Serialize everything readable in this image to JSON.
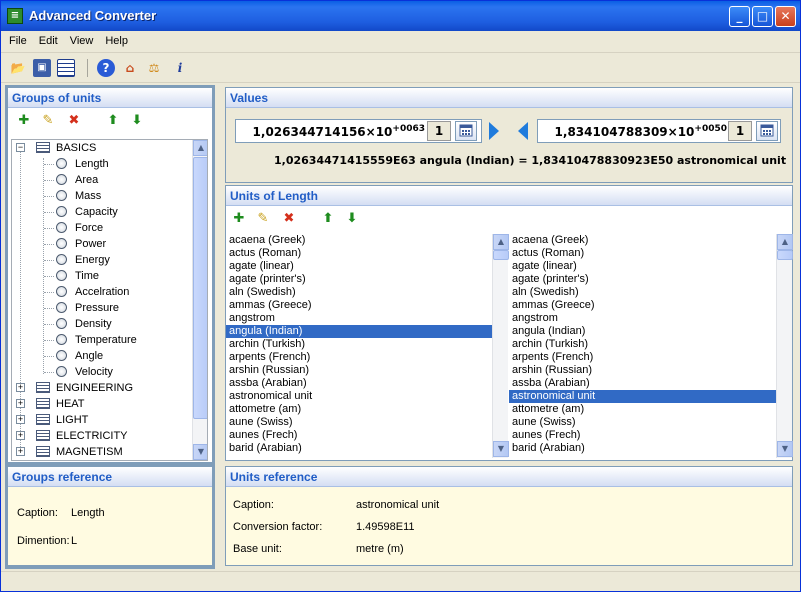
{
  "window": {
    "title": "Advanced Converter",
    "app_icon": "converter-app-icon"
  },
  "menu": [
    "File",
    "Edit",
    "View",
    "Help"
  ],
  "toolbar_icons": [
    "open-icon",
    "save-icon",
    "list-icon",
    "help-icon",
    "home-icon",
    "converter-icon",
    "info-icon"
  ],
  "groups": {
    "title": "Groups of units",
    "tools": [
      "add-group-icon",
      "edit-group-icon",
      "delete-group-icon",
      "move-up-icon",
      "move-down-icon"
    ],
    "tree": [
      {
        "label": "BASICS",
        "expanded": true,
        "children": [
          "Length",
          "Area",
          "Mass",
          "Capacity",
          "Force",
          "Power",
          "Energy",
          "Time",
          "Accelration",
          "Pressure",
          "Density",
          "Temperature",
          "Angle",
          "Velocity"
        ]
      },
      {
        "label": "ENGINEERING",
        "expanded": false
      },
      {
        "label": "HEAT",
        "expanded": false
      },
      {
        "label": "LIGHT",
        "expanded": false
      },
      {
        "label": "ELECTRICITY",
        "expanded": false
      },
      {
        "label": "MAGNETISM",
        "expanded": false
      }
    ]
  },
  "groups_reference": {
    "title": "Groups reference",
    "caption_label": "Caption:",
    "caption_value": "Length",
    "dimension_label": "Dimention:",
    "dimension_value": "L"
  },
  "values": {
    "title": "Values",
    "left": {
      "mantissa": "1,026344714156×10",
      "exponent": "+0063",
      "multiplier": "1"
    },
    "right": {
      "mantissa": "1,834104788309×10",
      "exponent": "+0050",
      "multiplier": "1"
    },
    "result": "1,02634471415559E63 angula (Indian) = 1,83410478830923E50 astronomical unit"
  },
  "units": {
    "title": "Units of Length",
    "tools": [
      "add-unit-icon",
      "edit-unit-icon",
      "delete-unit-icon",
      "unit-up-icon",
      "unit-down-icon"
    ],
    "list": [
      "acaena (Greek)",
      "actus (Roman)",
      "agate (linear)",
      "agate (printer's)",
      "aln (Swedish)",
      "ammas (Greece)",
      "angstrom",
      "angula (Indian)",
      "archin (Turkish)",
      "arpents (French)",
      "arshin (Russian)",
      "assba (Arabian)",
      "astronomical unit",
      "attometre (am)",
      "aune (Swiss)",
      "aunes (Frech)",
      "barid (Arabian)"
    ],
    "left_selected": "angula (Indian)",
    "right_selected": "astronomical unit",
    "selection_color": "#316ac5"
  },
  "units_reference": {
    "title": "Units reference",
    "caption_label": "Caption:",
    "caption_value": "astronomical unit",
    "factor_label": "Conversion factor:",
    "factor_value": "1.49598E11",
    "base_label": "Base unit:",
    "base_value": "metre (m)"
  },
  "colors": {
    "header_text": "#215dc6",
    "titlebar": "#1e5ee0",
    "reference_bg": "#fffbe1"
  }
}
